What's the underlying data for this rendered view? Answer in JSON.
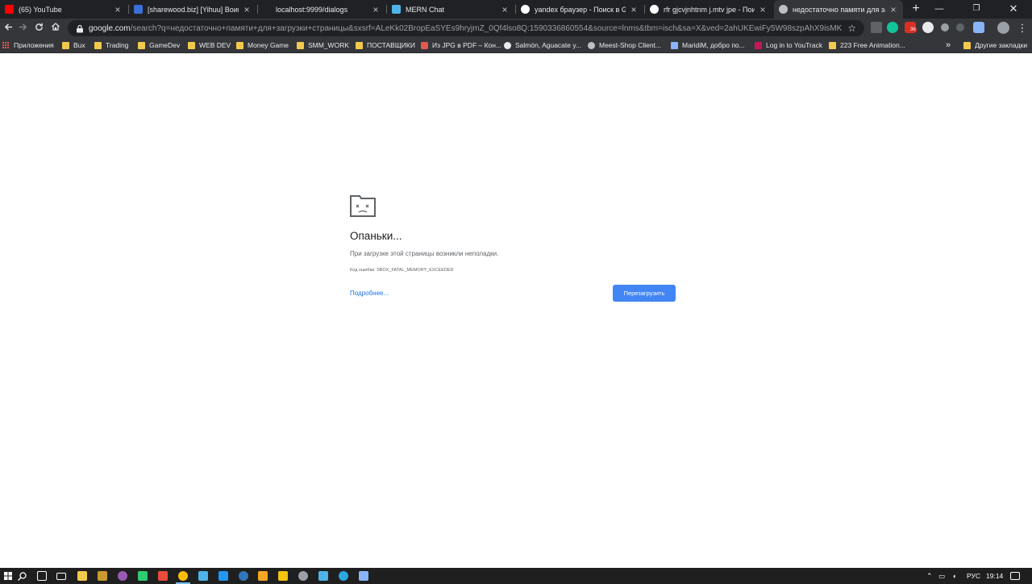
{
  "tabs": [
    {
      "title": "(65) YouTube",
      "favicon": "youtube-icon",
      "color": "#ff0000"
    },
    {
      "title": "[sharewood.biz] [Yihuu] Воин Ги",
      "favicon": "sharewood-icon",
      "color": "#3b6fd8"
    },
    {
      "title": "localhost:9999/dialogs",
      "favicon": "none",
      "color": ""
    },
    {
      "title": "MERN Chat",
      "favicon": "mern-icon",
      "color": "#4fb3e8"
    },
    {
      "title": "yandex браузер - Поиск в Goog",
      "favicon": "google-icon",
      "color": "#ffffff"
    },
    {
      "title": "rfr gjcvjnhtnm j.mtv jpe - Поиск",
      "favicon": "google-icon",
      "color": "#ffffff"
    },
    {
      "title": "недостаточно памяти для загру",
      "favicon": "globe-icon",
      "color": "#bdc1c6"
    }
  ],
  "toolbar": {
    "url_host": "google.com",
    "url_rest": "/search?q=недостаточно+памяти+для+загрузки+страницы&sxsrf=ALeKk02BropEaSYEs9hryjmZ_0Qf4lso8Q:1590336860554&source=lnms&tbm=isch&sa=X&ved=2ahUKEwiFy5W98szpAhX9isMKHUyfCpEQ_AU..."
  },
  "bookmarks": [
    "Приложения",
    "Bux",
    "Trading",
    "GameDev",
    "WEB DEV",
    "Money Game",
    "SMM_WORK",
    "ПОСТАВЩИКИ",
    "Из JPG в PDF – Кон...",
    "Salmón, Aguacate y...",
    "Meest-Shop Client...",
    "MaridiM, добро по...",
    "Log in to YouTrack",
    "223 Free Animation..."
  ],
  "bookmarks_other": "Другие закладки",
  "bookmarks_overflow": "»",
  "error": {
    "title": "Опаньки...",
    "description": "При загрузке этой страницы возникли неполадки.",
    "code": "Код ошибки: SBOX_FATAL_MEMORY_EXCEEDED",
    "learn_more": "Подробнее...",
    "reload": "Перезагрузить"
  },
  "taskbar": {
    "lang": "РУС",
    "time": "19:14"
  },
  "extension_badge": "36",
  "colors": {
    "tab_strip": "#202124",
    "toolbar": "#35363a",
    "accent_button": "#4285f4",
    "link": "#1a73e8"
  }
}
